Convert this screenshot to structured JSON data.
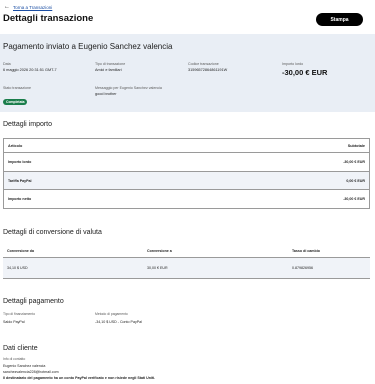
{
  "header": {
    "back_label": "Torna a Transazioni",
    "title": "Dettagli transazione",
    "print_label": "Stampa"
  },
  "summary": {
    "heading": "Pagamento inviato a Eugenio Sanchez valencia",
    "date_label": "Data",
    "date_value": "6 maggio 2026 20:31:51 GMT-7",
    "type_label": "Tipo di transazione",
    "type_value": "Amici e familiari",
    "code_label": "Codice transazione",
    "code_value": "31596572864861191W",
    "gross_label": "Importo lordo",
    "gross_value": "-30,00 € EUR",
    "status_label": "Stato transazione",
    "status_value": "Completata",
    "message_label": "Messaggio per Eugenio Sanchez valencia",
    "message_value": "good brother"
  },
  "amount_details": {
    "title": "Dettagli importo",
    "col_item": "Articolo",
    "col_subtotal": "Subtotale",
    "rows": [
      {
        "label": "Importo lordo",
        "value": "-30,00 € EUR"
      },
      {
        "label": "Tariffa PayPal",
        "value": "0,00 € EUR"
      },
      {
        "label": "Importo netto",
        "value": "-30,00 € EUR"
      }
    ]
  },
  "conversion": {
    "title": "Dettagli di conversione di valuta",
    "col_from": "Conversione da",
    "col_to": "Conversione a",
    "col_rate": "Tasso di cambio",
    "from_value": "34,10 $ USD",
    "to_value": "30,00 € EUR",
    "rate_value": "0.879826956"
  },
  "payment": {
    "title": "Dettagli pagamento",
    "funding_label": "Tipo di finanziamento",
    "funding_value": "Saldo PayPal",
    "method_label": "Metodo di pagamento",
    "method_value": "-34,10 $ USD - Conto PayPal"
  },
  "customer": {
    "title": "Dati cliente",
    "contact_label": "Info di contatto",
    "name": "Eugenio Sanchez valencia",
    "email": "sanchezvalencia228@hotmail.com",
    "note": "Il destinatario del pagamento ha un conto PayPal verificato e non risiede negli Stati Uniti."
  },
  "colors": {
    "summary_bg": "#e9eef5",
    "status_badge": "#1a7d4b",
    "link": "#1b4ea3",
    "button": "#000000"
  }
}
